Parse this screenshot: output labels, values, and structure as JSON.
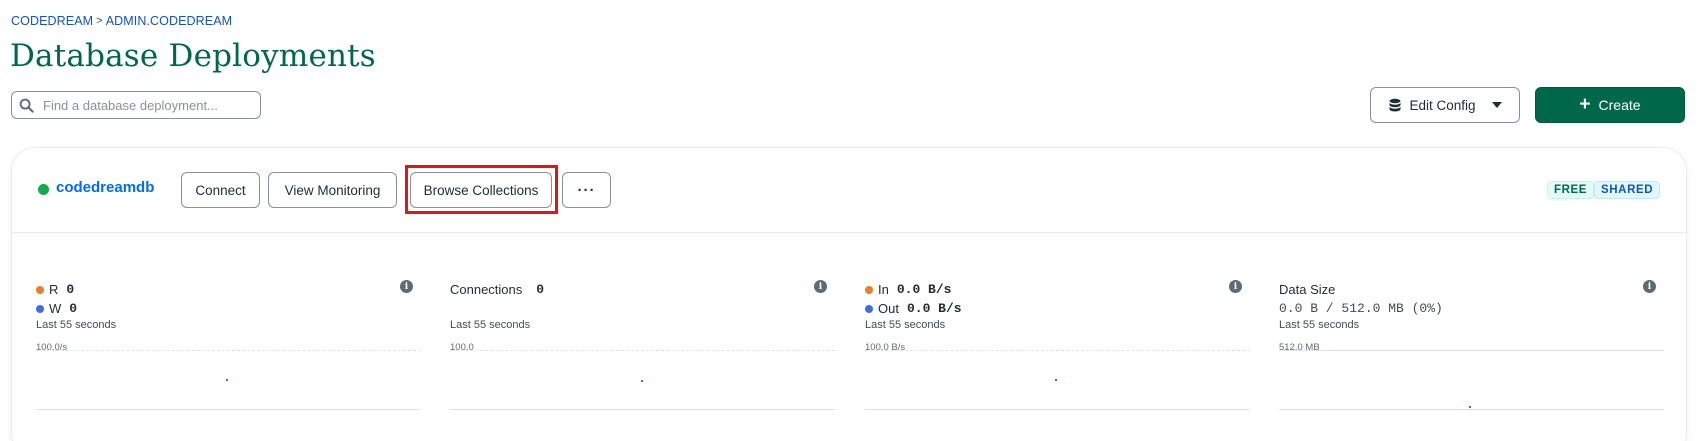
{
  "breadcrumb": {
    "org": "CODEDREAM",
    "separator": ">",
    "project": "ADMIN.CODEDREAM"
  },
  "page_title": "Database Deployments",
  "search": {
    "placeholder": "Find a database deployment..."
  },
  "toolbar": {
    "edit_config_label": "Edit Config",
    "create_label": "Create",
    "create_icon": "+"
  },
  "cluster": {
    "name": "codedreamdb",
    "status_color": "#13aa52",
    "buttons": {
      "connect": "Connect",
      "view_monitoring": "View Monitoring",
      "browse_collections": "Browse Collections",
      "more": "···"
    },
    "badges": {
      "free": "FREE",
      "shared": "SHARED"
    }
  },
  "metrics": {
    "ops": {
      "r_label": "R",
      "r_value": "0",
      "w_label": "W",
      "w_value": "0",
      "window": "Last 55 seconds",
      "scale": "100.0/s"
    },
    "connections": {
      "label": "Connections",
      "value": "0",
      "window": "Last 55 seconds",
      "scale": "100.0"
    },
    "network": {
      "in_label": "In",
      "in_value": "0.0 B/s",
      "out_label": "Out",
      "out_value": "0.0 B/s",
      "window": "Last 55 seconds",
      "scale": "100.0 B/s"
    },
    "data_size": {
      "label": "Data Size",
      "value": "0.0 B / 512.0 MB (0%)",
      "window": "Last 55 seconds",
      "scale": "512.0 MB"
    }
  },
  "colors": {
    "accent_green": "#00684a",
    "link_blue": "#016bf8",
    "highlight_red": "#e5141c",
    "read_orange": "#ed7b2a",
    "write_blue": "#3b6fe8"
  }
}
